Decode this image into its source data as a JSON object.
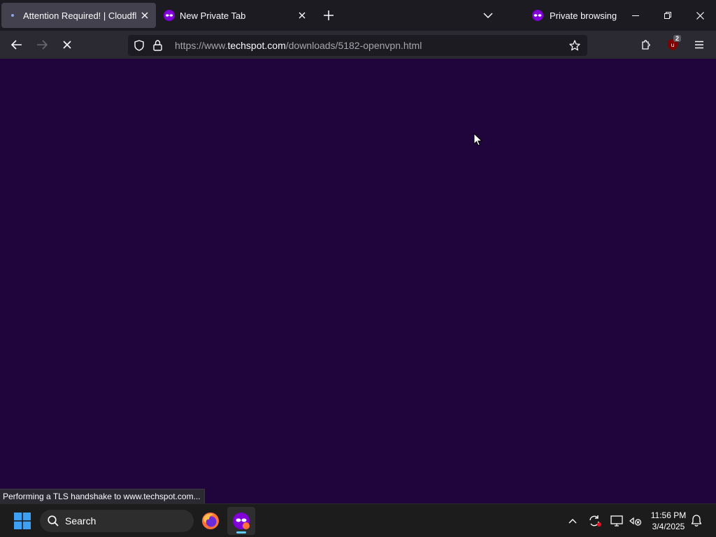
{
  "browser": {
    "tabs": [
      {
        "title": "Attention Required! | Cloudflare",
        "active": true,
        "favicon": "loading-dot-icon"
      },
      {
        "title": "New Private Tab",
        "active": false,
        "favicon": "private-mask-icon"
      }
    ],
    "private_label": "Private browsing",
    "url": {
      "scheme": "https://www.",
      "host": "techspot.com",
      "path": "/downloads/5182-openvpn.html"
    },
    "extension_badge": "2",
    "status_text": "Performing a TLS handshake to www.techspot.com..."
  },
  "taskbar": {
    "search_placeholder": "Search",
    "time": "11:56 PM",
    "date": "3/4/2025"
  },
  "colors": {
    "content_background": "#20053d",
    "tabstrip": "#1c1b22",
    "navbar": "#2b2a33",
    "private_accent": "#8000d7"
  }
}
